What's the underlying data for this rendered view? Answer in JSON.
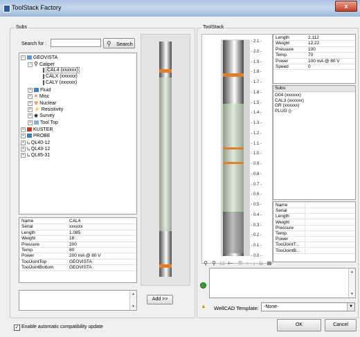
{
  "window": {
    "title": "ToolStack Factory",
    "close_label": "x"
  },
  "subs": {
    "legend": "Subs",
    "search_label": "Search for :",
    "search_value": "",
    "search_button": "Search",
    "tree": {
      "geovista": "GEOVISTA",
      "caliper": "Caliper",
      "cal4": "CAL4 (xxxxxx)",
      "calx": "CALX (xxxxxx)",
      "caly": "CALY (xxxxxx)",
      "fluid": "Fluid",
      "misc": "Misc",
      "nuclear": "Nuclear",
      "resistivity": "Resistivity",
      "survey": "Survey",
      "tooltop": "Tool Top",
      "kuster": "KUSTER",
      "probe": "PROBE",
      "ql40_12": "QL40-12",
      "ql43_12": "QL43-12",
      "ql85_31": "QL85-31"
    },
    "props": [
      {
        "k": "Name",
        "v": "CAL4"
      },
      {
        "k": "Serial",
        "v": "xxxxxx"
      },
      {
        "k": "Length",
        "v": "1.085"
      },
      {
        "k": "Weight",
        "v": "18"
      },
      {
        "k": "Pressure",
        "v": "200"
      },
      {
        "k": "Temp.",
        "v": "80"
      },
      {
        "k": "Power",
        "v": "200 mA @ 80 V"
      },
      {
        "k": "ToolJointTop",
        "v": "GEOVISTA"
      },
      {
        "k": "ToolJointBottom",
        "v": "GEOVISTA"
      }
    ],
    "add_button": "Add >>"
  },
  "toolstack": {
    "legend": "ToolStack",
    "depth_ticks": [
      "- 2.1 -",
      "- 2.0 -",
      "- 1.9 -",
      "- 1.8 -",
      "- 1.7 -",
      "- 1.6 -",
      "- 1.5 -",
      "- 1.4 -",
      "- 1.3 -",
      "- 1.2 -",
      "- 1.1 -",
      "- 1.0 -",
      "- 0.9 -",
      "- 0.8 -",
      "- 0.7 -",
      "- 0.6 -",
      "- 0.5 -",
      "- 0.4 -",
      "- 0.3 -",
      "- 0.2 -",
      "- 0.1 -",
      "- 0.0 -"
    ],
    "props": [
      {
        "k": "Length",
        "v": "2.112"
      },
      {
        "k": "Weight",
        "v": "12.22"
      },
      {
        "k": "Pressure",
        "v": "100"
      },
      {
        "k": "Temp.",
        "v": "70"
      },
      {
        "k": "Power",
        "v": "100 mA @ 80 V"
      },
      {
        "k": "Speed",
        "v": "0"
      }
    ],
    "subs_label": "Subs:",
    "subs_list": [
      "G04 (xxxxxx)",
      "CAL3 (xxxxxx)",
      "GR (xxxxxx)",
      "PLUG ()"
    ],
    "detail_fields": [
      "Name",
      "Serial",
      "Length",
      "Weight",
      "Pressure",
      "Temp.",
      "Power",
      "ToolJointT...",
      "ToolJointB..."
    ],
    "wellcad_label": "WellCAD Template:",
    "wellcad_value": "-None-"
  },
  "footer": {
    "checkbox_label": "Enable automatic compatibility update",
    "checkbox_checked": true,
    "ok": "OK",
    "cancel": "Cancel"
  }
}
